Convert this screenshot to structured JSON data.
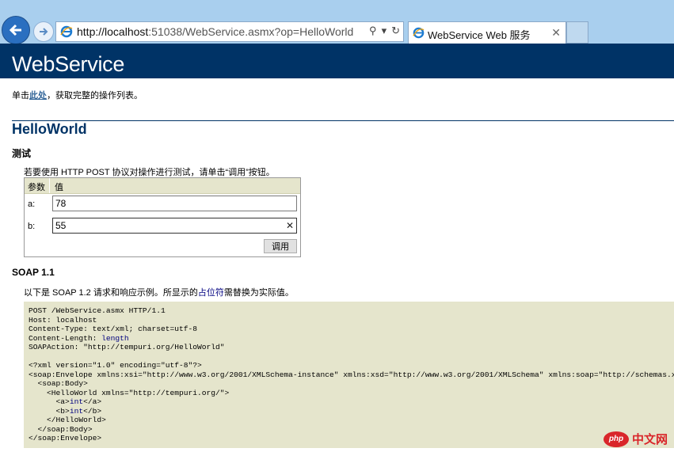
{
  "browser": {
    "url_host": "http://localhost",
    "url_rest": ":51038/WebService.asmx?op=HelloWorld",
    "tab_title": "WebService Web 服务"
  },
  "page": {
    "banner": "WebService",
    "intro_pre": "单击",
    "intro_link": "此处",
    "intro_post": "，获取完整的操作列表。",
    "operation_title": "HelloWorld",
    "test_heading": "测试",
    "test_note": "若要使用 HTTP POST 协议对操作进行测试，请单击“调用”按钮。",
    "table": {
      "col_param": "参数",
      "col_value": "值",
      "params": [
        {
          "label": "a:",
          "value": "78"
        },
        {
          "label": "b:",
          "value": "55"
        }
      ],
      "invoke_label": "调用"
    },
    "soap_heading": "SOAP 1.1",
    "soap_note_pre": "以下是 SOAP 1.2 请求和响应示例。所显示的",
    "soap_note_ph": "占位符",
    "soap_note_post": "需替换为实际值。",
    "soap_sample": {
      "line1": "POST /WebService.asmx HTTP/1.1",
      "line2": "Host: localhost",
      "line3": "Content-Type: text/xml; charset=utf-8",
      "line4a": "Content-Length: ",
      "line4_ph": "length",
      "line5": "SOAPAction: \"http://tempuri.org/HelloWorld\"",
      "line6": "<?xml version=\"1.0\" encoding=\"utf-8\"?>",
      "line7": "<soap:Envelope xmlns:xsi=\"http://www.w3.org/2001/XMLSchema-instance\" xmlns:xsd=\"http://www.w3.org/2001/XMLSchema\" xmlns:soap=\"http://schemas.xmlsoap.org/soap/envelope/\">",
      "line8": "  <soap:Body>",
      "line9": "    <HelloWorld xmlns=\"http://tempuri.org/\">",
      "line10a": "      <a>",
      "line10_ph": "int",
      "line10b": "</a>",
      "line11a": "      <b>",
      "line11_ph": "int",
      "line11b": "</b>",
      "line12": "    </HelloWorld>",
      "line13": "  </soap:Body>",
      "line14": "</soap:Envelope>"
    },
    "watermark": {
      "logo": "php",
      "text": "中文网"
    }
  }
}
